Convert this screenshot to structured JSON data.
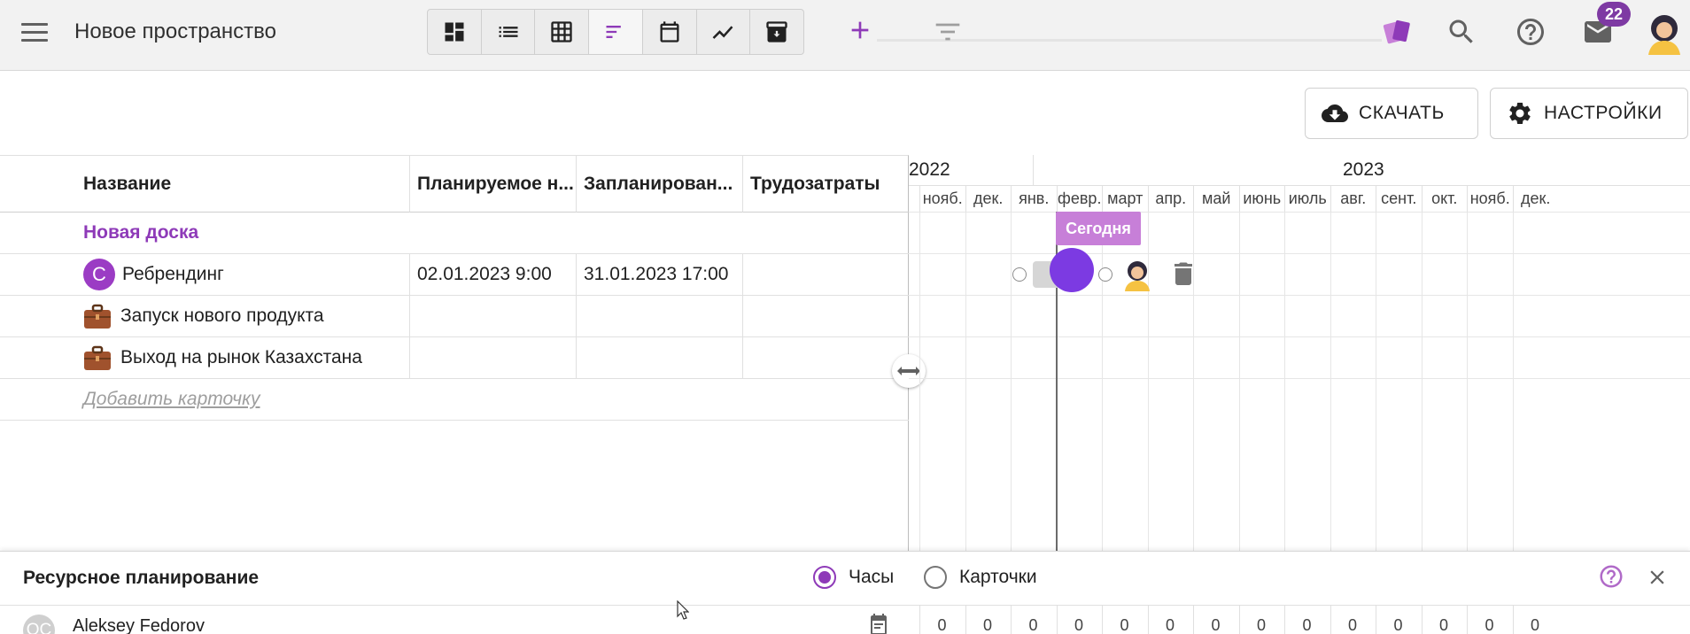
{
  "header": {
    "space_title": "Новое пространство",
    "notifications_count": "22"
  },
  "actions": {
    "download_label": "СКАЧАТЬ",
    "settings_label": "НАСТРОЙКИ"
  },
  "grid": {
    "columns": [
      "Название",
      "Планируемое н...",
      "Запланирован...",
      "Трудозатраты"
    ],
    "group_label": "Новая доска",
    "rows": [
      {
        "badge": "С",
        "name": "Ребрендинг",
        "start": "02.01.2023 9:00",
        "end": "31.01.2023 17:00",
        "effort": ""
      },
      {
        "name": "Запуск нового продукта",
        "start": "",
        "end": "",
        "effort": ""
      },
      {
        "name": "Выход на рынок Казахстана",
        "start": "",
        "end": "",
        "effort": ""
      }
    ],
    "add_card_label": "Добавить карточку"
  },
  "timeline": {
    "years": [
      "2022",
      "2023"
    ],
    "months": [
      "нояб.",
      "дек.",
      "янв.",
      "февр.",
      "март",
      "апр.",
      "май",
      "июнь",
      "июль",
      "авг.",
      "сент.",
      "окт.",
      "нояб.",
      "дек."
    ],
    "today_label": "Сегодня"
  },
  "resource": {
    "title": "Ресурсное планирование",
    "option_hours": "Часы",
    "option_cards": "Карточки",
    "selected_option": "Часы",
    "user": {
      "initials": "OC",
      "name": "Aleksey Fedorov"
    },
    "values": [
      "0",
      "0",
      "0",
      "0",
      "0",
      "0",
      "0",
      "0",
      "0",
      "0",
      "0",
      "0",
      "0",
      "0"
    ]
  },
  "colors": {
    "accent": "#8e3ab8",
    "today": "#c77fd8",
    "marker": "#7c3ae2"
  }
}
